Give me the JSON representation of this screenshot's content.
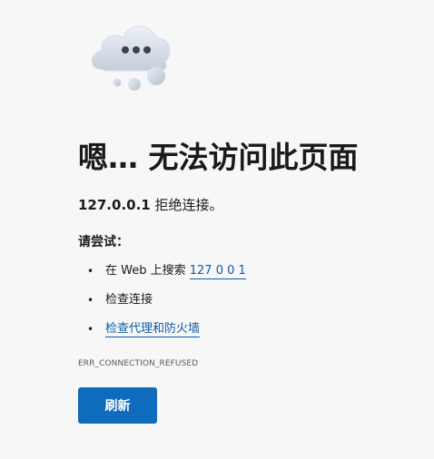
{
  "illustration": {
    "icon": "cloud-with-ellipsis-icon"
  },
  "heading": {
    "title": "嗯… 无法访问此页面"
  },
  "message": {
    "host": "127.0.0.1",
    "text": " 拒绝连接。"
  },
  "suggestions": {
    "label": "请尝试：",
    "items": [
      {
        "prefix": "在 Web 上搜索 ",
        "link": "127 0 0 1"
      },
      {
        "text": "检查连接"
      },
      {
        "link": "检查代理和防火墙"
      }
    ]
  },
  "error": {
    "code": "ERR_CONNECTION_REFUSED"
  },
  "actions": {
    "refresh_label": "刷新"
  },
  "colors": {
    "accent": "#0f6cbd",
    "link": "#0f5ca8",
    "background": "#f7f7f7"
  }
}
